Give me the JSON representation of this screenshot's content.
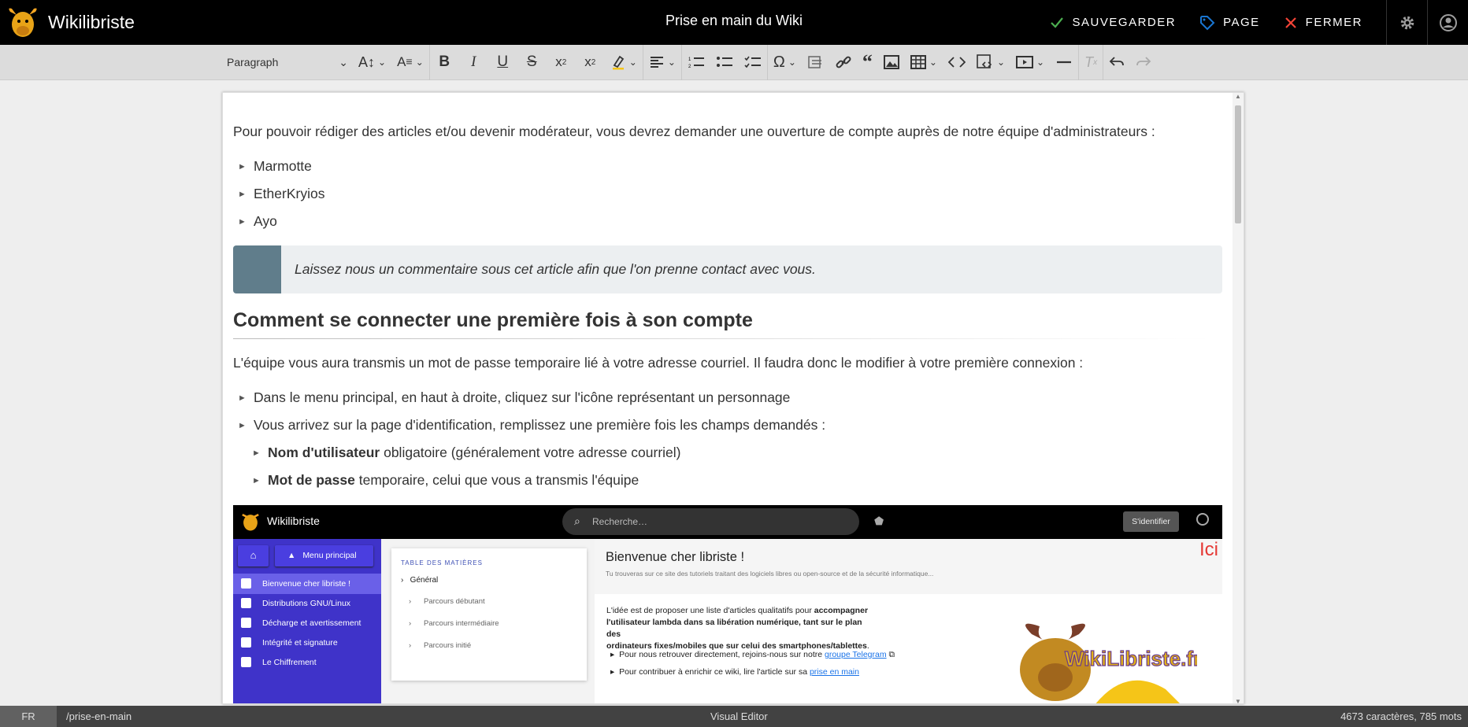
{
  "app": {
    "name": "Wikilibriste",
    "page_title": "Prise en main du Wiki"
  },
  "actions": {
    "save": "SAUVEGARDER",
    "page": "PAGE",
    "close": "FERMER"
  },
  "toolbar": {
    "format": "Paragraph"
  },
  "content": {
    "intro": "Pour pouvoir rédiger des articles et/ou devenir modérateur, vous devrez demander une ouverture de compte auprès de notre équipe d'administrateurs :",
    "admins": [
      "Marmotte",
      "EtherKryios",
      "Ayo"
    ],
    "quote": "Laissez nous un commentaire sous cet article afin que l'on prenne contact avec vous.",
    "heading": "Comment se connecter une première fois à son compte",
    "para": "L'équipe vous aura transmis un mot de passe temporaire lié à votre adresse courriel. Il faudra donc le modifier à votre première connexion :",
    "step1": "Dans le menu principal, en haut à droite, cliquez sur l'icône représentant un personnage",
    "step2": "Vous arrivez sur la page d'identification, remplissez une première fois les champs demandés :",
    "sub1_bold": "Nom d'utilisateur",
    "sub1_rest": " obligatoire (généralement votre adresse courriel)",
    "sub2_bold": "Mot de passe",
    "sub2_rest": " temporaire, celui que vous a transmis l'équipe"
  },
  "screenshot": {
    "site": "Wikilibriste",
    "search": "Recherche…",
    "login": "S'identifier",
    "ici": "Ici",
    "menu": "Menu principal",
    "side": [
      "Bienvenue cher libriste !",
      "Distributions GNU/Linux",
      "Décharge et avertissement",
      "Intégrité et signature",
      "Le Chiffrement"
    ],
    "toc_title": "TABLE DES MATIÈRES",
    "toc": [
      "Général",
      "Parcours débutant",
      "Parcours intermédiaire",
      "Parcours initié"
    ],
    "welcome": "Bienvenue cher libriste !",
    "welcome_sub": "Tu trouveras sur ce site des tutoriels traitant des logiciels libres ou open-source et de la sécurité informatique...",
    "idea_1": "L'idée est de proposer une liste d'articles qualitatifs pour ",
    "idea_b1": "accompagner",
    "idea_b2": "l'utilisateur lambda dans sa libération numérique, tant sur le plan des",
    "idea_b3": "ordinateurs fixes/mobiles que sur celui des smartphones/tablettes",
    "b1": "Pour nous retrouver directement, rejoins-nous sur notre ",
    "b1_link": "groupe Telegram",
    "b2": "Pour contribuer à enrichir ce wiki, lire l'article sur sa ",
    "b2_link": "prise en main",
    "brand": "WikiLibriste.fr"
  },
  "status": {
    "lang": "FR",
    "path": "/prise-en-main",
    "mode": "Visual Editor",
    "count": "4673 caractères, 785 mots"
  },
  "colors": {
    "accent": "#1976d2",
    "save": "#4caf50",
    "close": "#f44336"
  }
}
